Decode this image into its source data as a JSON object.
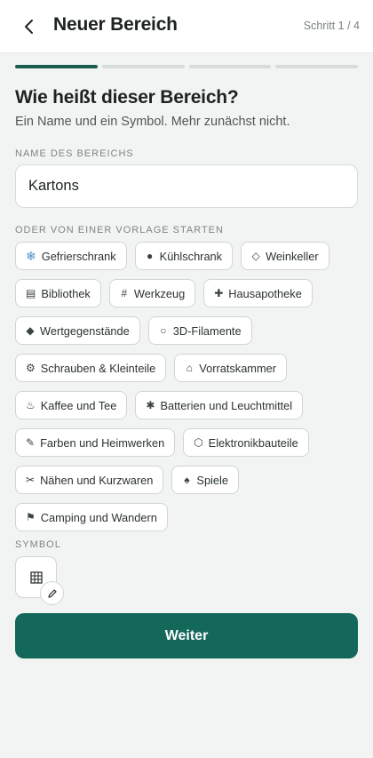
{
  "header": {
    "title": "Neuer Bereich",
    "step": "Schritt 1 / 4"
  },
  "progress": {
    "total_steps": 4,
    "current_step": 1
  },
  "question": {
    "title": "Wie heißt dieser Bereich?",
    "subtitle": "Ein Name und ein Symbol. Mehr zunächst nicht."
  },
  "name_field": {
    "label": "NAME DES BEREICHS",
    "value": "Kartons"
  },
  "templates": {
    "label": "ODER VON EINER VORLAGE STARTEN",
    "items": [
      {
        "icon": "❄",
        "icon_name": "snowflake-icon",
        "label": "Gefrierschrank"
      },
      {
        "icon": "●",
        "icon_name": "dot-icon",
        "label": "Kühlschrank"
      },
      {
        "icon": "◇",
        "icon_name": "diamond-outline-icon",
        "label": "Weinkeller"
      },
      {
        "icon": "▤",
        "icon_name": "book-icon",
        "label": "Bibliothek"
      },
      {
        "icon": "#",
        "icon_name": "hash-icon",
        "label": "Werkzeug"
      },
      {
        "icon": "✚",
        "icon_name": "cross-icon",
        "label": "Hausapotheke"
      },
      {
        "icon": "◆",
        "icon_name": "diamond-icon",
        "label": "Wertgegenstände"
      },
      {
        "icon": "○",
        "icon_name": "circle-icon",
        "label": "3D-Filamente"
      },
      {
        "icon": "⚙",
        "icon_name": "gear-icon",
        "label": "Schrauben & Kleinteile"
      },
      {
        "icon": "⌂",
        "icon_name": "house-icon",
        "label": "Vorratskammer"
      },
      {
        "icon": "♨",
        "icon_name": "hot-drink-icon",
        "label": "Kaffee und Tee"
      },
      {
        "icon": "✱",
        "icon_name": "asterisk-icon",
        "label": "Batterien und Leuchtmittel"
      },
      {
        "icon": "✎",
        "icon_name": "brush-icon",
        "label": "Farben und Heimwerken"
      },
      {
        "icon": "⬡",
        "icon_name": "hexagon-icon",
        "label": "Elektronikbauteile"
      },
      {
        "icon": "✂",
        "icon_name": "scissors-icon",
        "label": "Nähen und Kurzwaren"
      },
      {
        "icon": "♠",
        "icon_name": "spade-icon",
        "label": "Spiele"
      },
      {
        "icon": "⚑",
        "icon_name": "flag-icon",
        "label": "Camping und Wandern"
      }
    ]
  },
  "symbol": {
    "label": "SYMBOL",
    "icon_name": "grid-icon"
  },
  "actions": {
    "next_label": "Weiter"
  },
  "colors": {
    "accent": "#13685a",
    "progress_active": "#1b5e50",
    "progress_inactive": "#d5dcd9",
    "background": "#f2f4f3"
  }
}
